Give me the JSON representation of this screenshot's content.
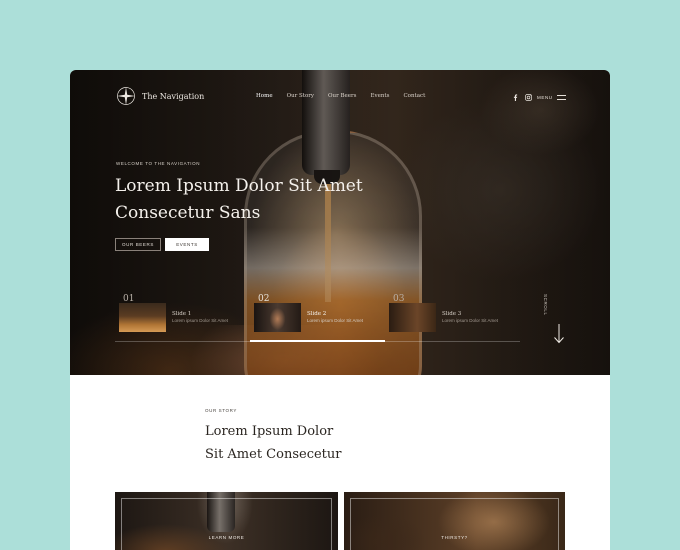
{
  "brand": {
    "name": "The Navigation"
  },
  "nav": {
    "items": [
      "Home",
      "Our Story",
      "Our Beers",
      "Events",
      "Contact"
    ],
    "active": "Home"
  },
  "header": {
    "menu_label": "MENU",
    "social": [
      "facebook-icon",
      "instagram-icon"
    ]
  },
  "hero": {
    "eyebrow": "WELCOME TO THE NAVIGATION",
    "headline_line1": "Lorem Ipsum Dolor Sit Amet",
    "headline_line2": "Consecetur Sans",
    "btn_primary": "OUR BEERS",
    "btn_secondary": "EVENTS"
  },
  "slides": [
    {
      "num": "01",
      "title": "Slide 1",
      "sub": "Lorem ipsum Dolor Sit Amet"
    },
    {
      "num": "02",
      "title": "Slide 2",
      "sub": "Lorem ipsum Dolor Sit Amet"
    },
    {
      "num": "03",
      "title": "Slide 3",
      "sub": "Lorem ipsum Dolor Sit Amet"
    }
  ],
  "active_slide": 2,
  "scroll_label": "SCROLL",
  "story": {
    "eyebrow": "OUR STORY",
    "title_line1": "Lorem Ipsum Dolor",
    "title_line2": "Sit Amet Consecetur"
  },
  "cards": [
    {
      "label": "LEARN MORE"
    },
    {
      "label": "THIRSTY?"
    }
  ],
  "colors": {
    "page_bg": "#acdfd9",
    "hero_text": "#f5f1ec",
    "body_text": "#2a2520"
  }
}
